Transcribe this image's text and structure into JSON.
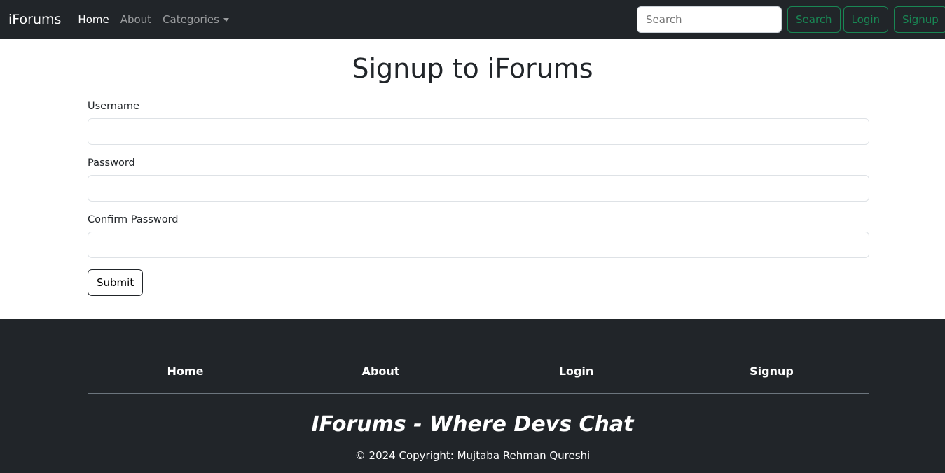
{
  "nav": {
    "brand": "iForums",
    "home": "Home",
    "about": "About",
    "categories": "Categories",
    "search_placeholder": "Search",
    "search_btn": "Search",
    "login": "Login",
    "signup": "Signup"
  },
  "form": {
    "title": "Signup to iForums",
    "username": "Username",
    "password": "Password",
    "confirm": "Confirm Password",
    "submit": "Submit"
  },
  "footer": {
    "links": [
      "Home",
      "About",
      "Login",
      "Signup"
    ],
    "tagline": "IForums - Where Devs Chat",
    "copy": "© 2024 Copyright: ",
    "author": "Mujtaba Rehman Qureshi"
  },
  "colors": {
    "dark": "#212529",
    "success": "#198754"
  }
}
